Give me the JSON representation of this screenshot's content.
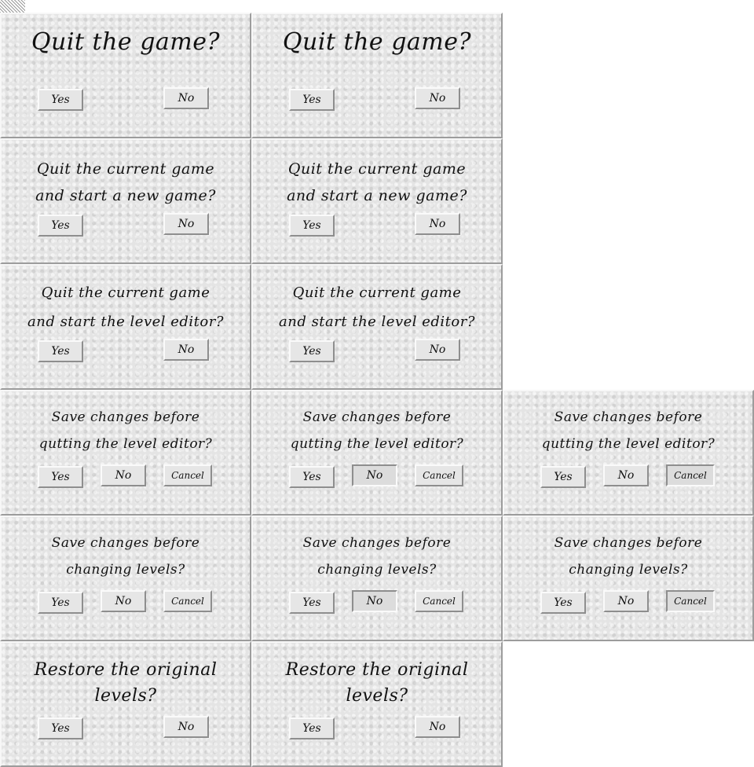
{
  "dialogs": {
    "quit_game": {
      "prompt": "Quit the game?"
    },
    "quit_new_game": {
      "line1": "Quit the current game",
      "line2": "and start a new game?"
    },
    "quit_level_editor": {
      "line1": "Quit the current game",
      "line2": "and start the level editor?"
    },
    "save_quit_editor": {
      "line1": "Save changes before",
      "line2": "qutting the level editor?"
    },
    "save_change_levels": {
      "line1": "Save changes before",
      "line2": "changing levels?"
    },
    "restore_levels": {
      "line1": "Restore the original",
      "line2": "levels?"
    }
  },
  "buttons": {
    "yes": "Yes",
    "no": "No",
    "cancel": "Cancel"
  }
}
